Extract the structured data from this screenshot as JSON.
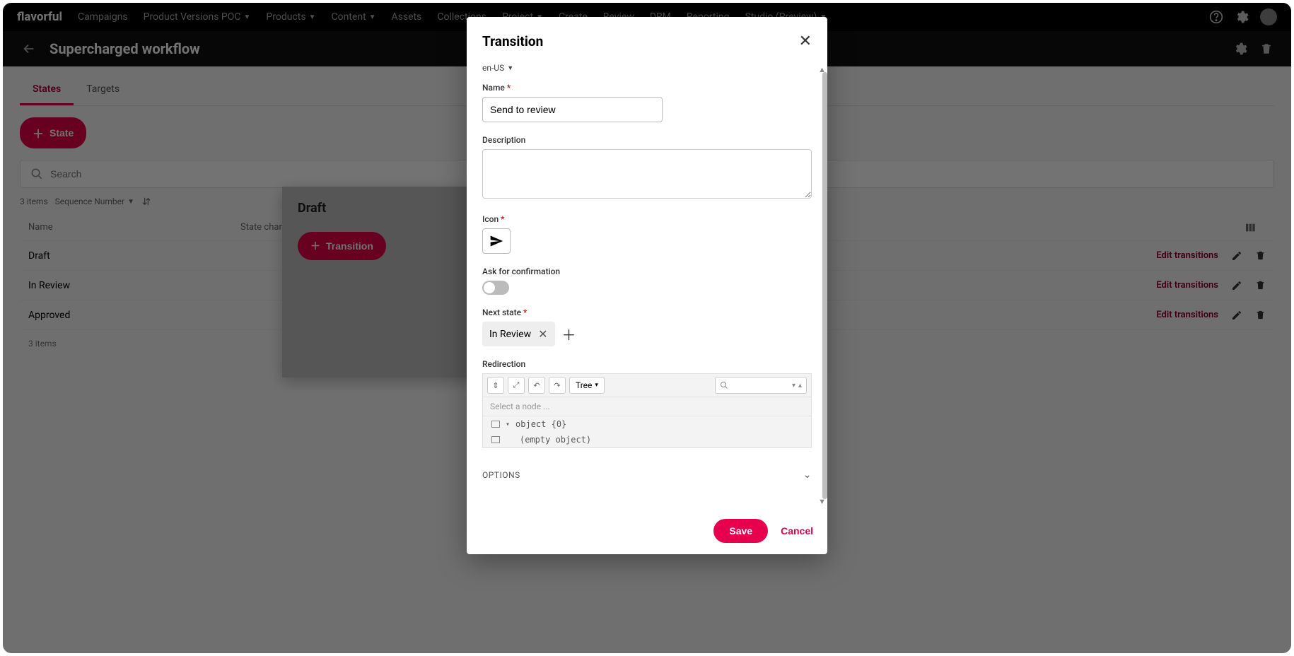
{
  "brand": "flavorful",
  "nav": {
    "items": [
      {
        "label": "Campaigns",
        "dropdown": false
      },
      {
        "label": "Product Versions POC",
        "dropdown": true
      },
      {
        "label": "Products",
        "dropdown": true
      },
      {
        "label": "Content",
        "dropdown": true
      },
      {
        "label": "Assets",
        "dropdown": false
      },
      {
        "label": "Collections",
        "dropdown": false
      },
      {
        "label": "Project",
        "dropdown": true
      },
      {
        "label": "Create",
        "dropdown": false
      },
      {
        "label": "Review",
        "dropdown": false
      },
      {
        "label": "DRM",
        "dropdown": false
      },
      {
        "label": "Reporting",
        "dropdown": false
      },
      {
        "label": "Studio (Preview)",
        "dropdown": true
      }
    ]
  },
  "header": {
    "title": "Supercharged workflow"
  },
  "tabs": {
    "active": "States",
    "items": [
      "States",
      "Targets"
    ]
  },
  "stateButton": "State",
  "search": {
    "placeholder": "Search"
  },
  "listMeta": {
    "count": "3 items",
    "sort": "Sequence Number"
  },
  "table": {
    "columns": {
      "name": "Name",
      "changes": "State changes"
    },
    "rows": [
      {
        "name": "Draft"
      },
      {
        "name": "In Review"
      },
      {
        "name": "Approved"
      }
    ],
    "editLabel": "Edit transitions",
    "footer": "3 items"
  },
  "draftPanel": {
    "title": "Draft",
    "transitionBtn": "Transition"
  },
  "modal": {
    "title": "Transition",
    "locale": "en-US",
    "fields": {
      "name": {
        "label": "Name",
        "value": "Send to review"
      },
      "description": {
        "label": "Description",
        "value": ""
      },
      "icon": {
        "label": "Icon"
      },
      "confirmation": {
        "label": "Ask for confirmation",
        "value": false
      },
      "nextState": {
        "label": "Next state",
        "chips": [
          "In Review"
        ]
      },
      "redirection": {
        "label": "Redirection",
        "viewMode": "Tree",
        "nodePlaceholder": "Select a node ...",
        "objectLabel": "object {0}",
        "emptyLabel": "(empty object)"
      },
      "options": {
        "label": "OPTIONS"
      }
    },
    "buttons": {
      "save": "Save",
      "cancel": "Cancel"
    }
  }
}
